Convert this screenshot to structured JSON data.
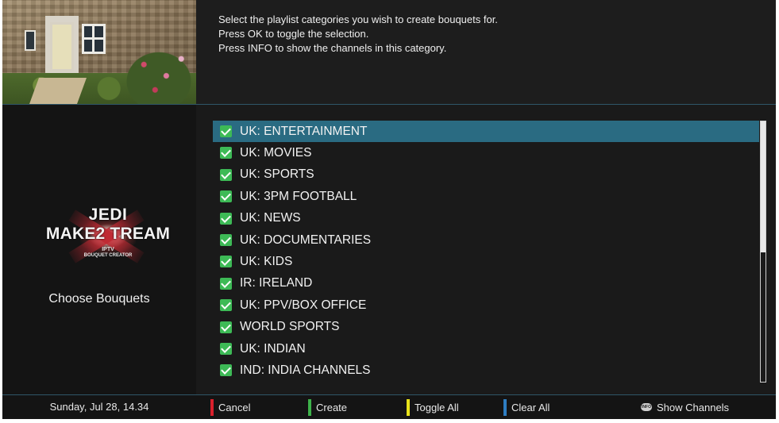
{
  "colors": {
    "selection": "#2a6b82",
    "check": "#3dba56",
    "red": "#d9202c",
    "green": "#3db24a",
    "yellow": "#e8e21a",
    "blue": "#2e7dc2"
  },
  "preview": {
    "icon": "cottage-preview-image"
  },
  "logo": {
    "line1": "JEDI",
    "line2": "MAKE2 TREAM",
    "line3": "IPTV",
    "line4": "BOUQUET CREATOR"
  },
  "left_title": "Choose Bouquets",
  "instructions": [
    "Select the playlist categories you wish to create bouquets for.",
    "Press OK to toggle the selection.",
    "Press INFO to show the channels in this category."
  ],
  "categories": [
    {
      "label": "UK: ENTERTAINMENT",
      "checked": true,
      "selected": true
    },
    {
      "label": "UK: MOVIES",
      "checked": true,
      "selected": false
    },
    {
      "label": "UK: SPORTS",
      "checked": true,
      "selected": false
    },
    {
      "label": "UK: 3PM FOOTBALL",
      "checked": true,
      "selected": false
    },
    {
      "label": "UK: NEWS",
      "checked": true,
      "selected": false
    },
    {
      "label": "UK: DOCUMENTARIES",
      "checked": true,
      "selected": false
    },
    {
      "label": "UK: KIDS",
      "checked": true,
      "selected": false
    },
    {
      "label": "IR: IRELAND",
      "checked": true,
      "selected": false
    },
    {
      "label": "UK: PPV/BOX OFFICE",
      "checked": true,
      "selected": false
    },
    {
      "label": "WORLD SPORTS",
      "checked": true,
      "selected": false
    },
    {
      "label": "UK: INDIAN",
      "checked": true,
      "selected": false
    },
    {
      "label": "IND: INDIA CHANNELS",
      "checked": true,
      "selected": false
    }
  ],
  "footer": {
    "datetime": "Sunday, Jul 28, 14.34",
    "cancel": "Cancel",
    "create": "Create",
    "toggle_all": "Toggle All",
    "clear_all": "Clear All",
    "info_badge": "INFO",
    "show_channels": "Show Channels"
  }
}
